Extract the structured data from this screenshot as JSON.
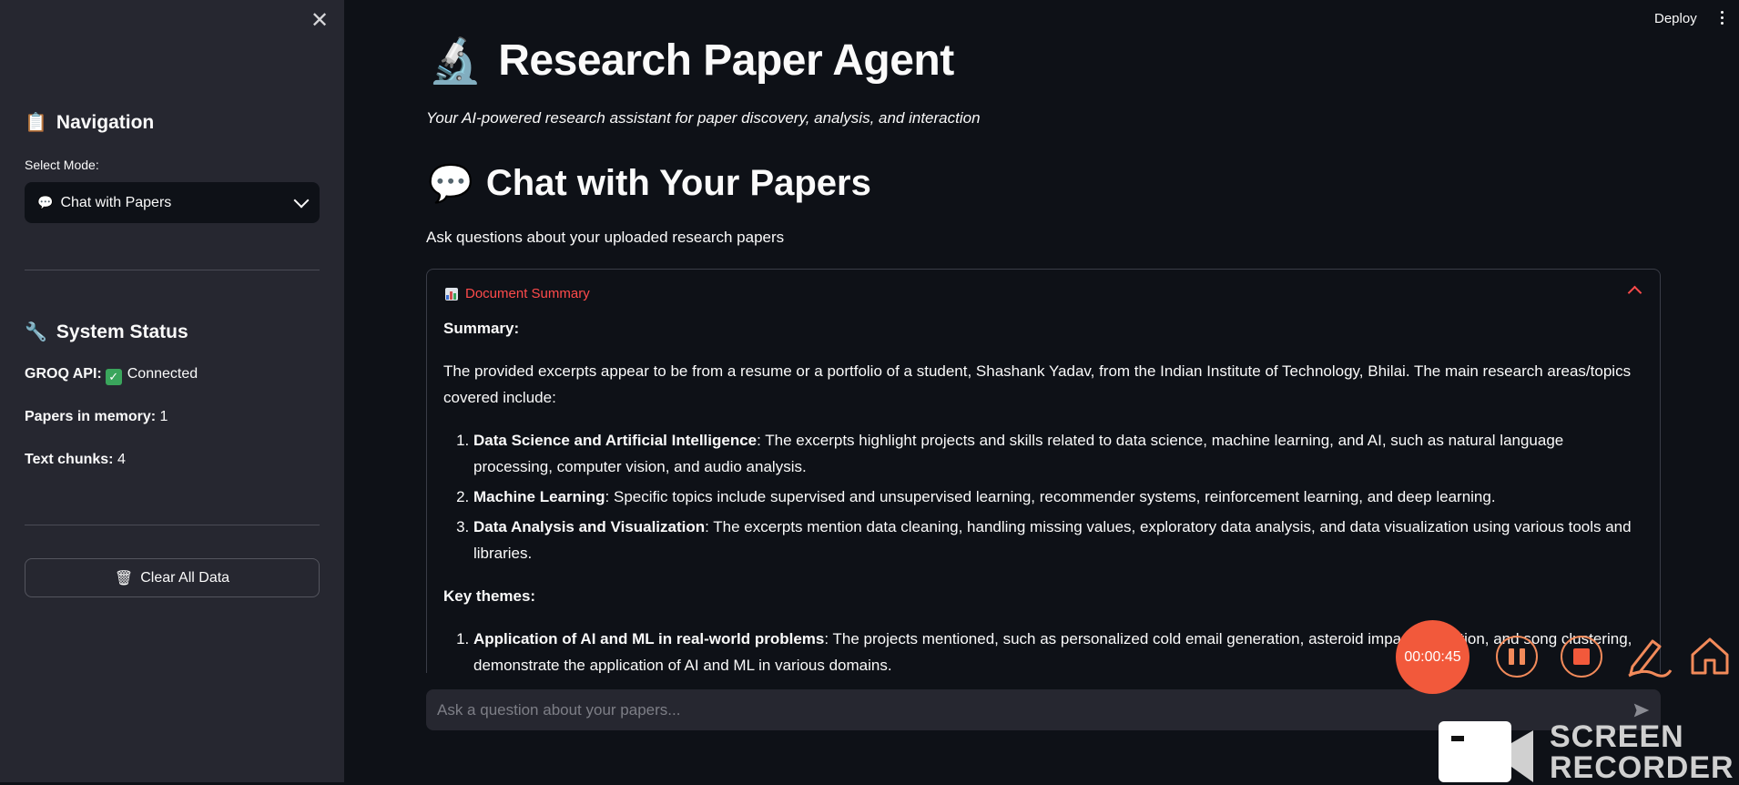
{
  "sidebar": {
    "navigation_title": "Navigation",
    "navigation_emoji": "📋",
    "select_label": "Select Mode:",
    "select_value": "Chat with Papers",
    "select_emoji": "💬",
    "status_title": "System Status",
    "status_emoji": "🔧",
    "groq_label": "GROQ API:",
    "groq_value": "Connected",
    "papers_label": "Papers in memory:",
    "papers_value": "1",
    "chunks_label": "Text chunks:",
    "chunks_value": "4",
    "clear_label": "Clear All Data",
    "clear_emoji": "🗑"
  },
  "topbar": {
    "deploy_label": "Deploy"
  },
  "main": {
    "title": "Research Paper Agent",
    "title_emoji": "🔬",
    "subtitle": "Your AI-powered research assistant for paper discovery, analysis, and interaction",
    "section_title": "Chat with Your Papers",
    "section_emoji": "💬",
    "section_desc": "Ask questions about your uploaded research papers"
  },
  "expander": {
    "title": "Document Summary",
    "summary_heading": "Summary:",
    "summary_text": "The provided excerpts appear to be from a resume or a portfolio of a student, Shashank Yadav, from the Indian Institute of Technology, Bhilai. The main research areas/topics covered include:",
    "topics": [
      {
        "term": "Data Science and Artificial Intelligence",
        "text": ": The excerpts highlight projects and skills related to data science, machine learning, and AI, such as natural language processing, computer vision, and audio analysis."
      },
      {
        "term": "Machine Learning",
        "text": ": Specific topics include supervised and unsupervised learning, recommender systems, reinforcement learning, and deep learning."
      },
      {
        "term": "Data Analysis and Visualization",
        "text": ": The excerpts mention data cleaning, handling missing values, exploratory data analysis, and data visualization using various tools and libraries."
      }
    ],
    "themes_heading": "Key themes:",
    "themes": [
      {
        "term": "Application of AI and ML in real-world problems",
        "text": ": The projects mentioned, such as personalized cold email generation, asteroid impact prediction, and song clustering, demonstrate the application of AI and ML in various domains."
      }
    ]
  },
  "chat": {
    "placeholder": "Ask a question about your papers..."
  },
  "recorder": {
    "time": "00:00:45",
    "brand_line1": "SCREEN",
    "brand_line2": "RECORDER"
  },
  "colors": {
    "accent": "#ff4b4b",
    "sidebar_bg": "#262730",
    "main_bg": "#0e1117",
    "recorder": "#f2593b"
  },
  "icons": {
    "close": "close-icon",
    "chevron": "chevron-down-icon",
    "check": "check-icon",
    "send": "send-icon",
    "pause": "pause-icon",
    "stop": "stop-icon",
    "pen": "pen-icon",
    "home": "home-icon"
  }
}
